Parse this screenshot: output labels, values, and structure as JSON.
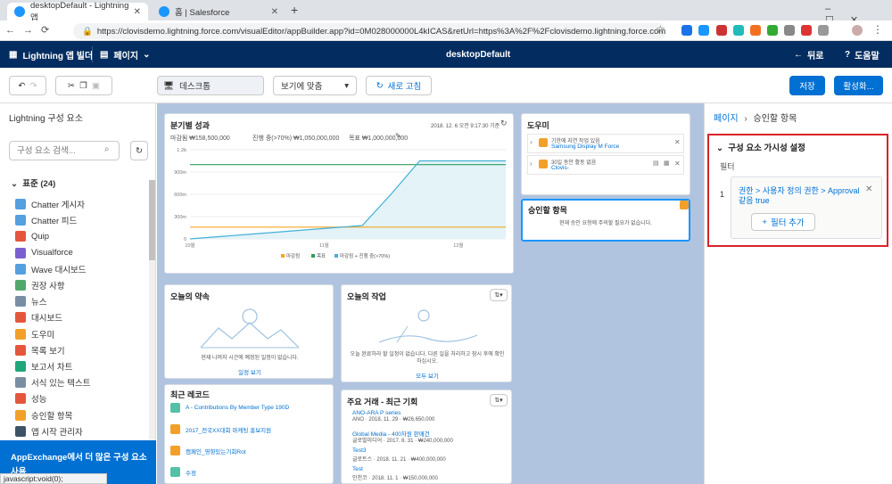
{
  "browser": {
    "tabs": [
      {
        "title": "desktopDefault - Lightning 앱"
      },
      {
        "title": "홈 | Salesforce"
      }
    ],
    "new_tab": "+",
    "url": "https://clovisdemo.lightning.force.com/visualEditor/appBuilder.app?id=0M028000000L4kICAS&retUrl=https%3A%2F%2Fclovisdemo.lightning.force.com..."
  },
  "header": {
    "app_title": "Lightning 앱 빌더",
    "page_menu": "페이지",
    "page_name": "desktopDefault",
    "back": "뒤로",
    "help": "도움말"
  },
  "toolbar": {
    "device": "데스크톱",
    "fit": "보기에 맞춤",
    "refresh": "새로 고침",
    "save": "저장",
    "activate": "활성화..."
  },
  "left": {
    "title": "Lightning 구성 요소",
    "search_placeholder": "구성 요소 검색...",
    "section": "표준 (24)",
    "items": [
      {
        "label": "Chatter 게시자",
        "color": "#54a0e0"
      },
      {
        "label": "Chatter 피드",
        "color": "#54a0e0"
      },
      {
        "label": "Quip",
        "color": "#e4573d"
      },
      {
        "label": "Visualforce",
        "color": "#7b5fd1"
      },
      {
        "label": "Wave 대시보드",
        "color": "#54a0e0"
      },
      {
        "label": "권장 사항",
        "color": "#51a86d"
      },
      {
        "label": "뉴스",
        "color": "#7a8ea3"
      },
      {
        "label": "대시보드",
        "color": "#e4573d"
      },
      {
        "label": "도우미",
        "color": "#f2a02a"
      },
      {
        "label": "목록 보기",
        "color": "#e4573d"
      },
      {
        "label": "보고서 차트",
        "color": "#1fa67a"
      },
      {
        "label": "서식 있는 텍스트",
        "color": "#7a8ea3"
      },
      {
        "label": "성능",
        "color": "#e4573d"
      },
      {
        "label": "승인할 항목",
        "color": "#f2a02a"
      },
      {
        "label": "앱 시작 관리자",
        "color": "#3e5266"
      }
    ],
    "appexchange": "AppExchange에서 더 많은 구성 요소 사용"
  },
  "canvas": {
    "perf": {
      "title": "분기별 성과",
      "timestamp": "2018. 12. 6 오전 9:17:30 기준",
      "closed": "마감됨 ₩158,500,000",
      "in_progress": "진행 중(>70%) ₩1,050,000,000",
      "goal": "목표 ₩1,000,000,000"
    },
    "assistant": {
      "title": "도우미",
      "item1_text": "기한에 지연 작업 있음",
      "item1_link": "Samsung Display M Force",
      "item2_text": "30일 동안 활동 없음",
      "item2_link": "Clovis-"
    },
    "approvals": {
      "title": "승인할 항목",
      "empty": "현재 승인 요청에 주의할 필요가 없습니다."
    },
    "events": {
      "title": "오늘의 약속",
      "empty": "현재 나머지 시간에 예정된 일정이 없습니다.",
      "link": "일정 보기"
    },
    "tasks": {
      "title": "오늘의 작업",
      "empty": "오늘 완료하라 할 일정이 없습니다. 다른 일을 처리하고 잠시 후에 확인하십시오.",
      "link": "모두 보기"
    },
    "recent": {
      "title": "최근 레코드",
      "items": [
        "A - Contributions By Member Type 190D",
        "2017_전국XX대회 마케팅 홍보지원",
        "캠페인_영향있는기회Rot",
        "수정"
      ]
    },
    "deals": {
      "title": "주요 거래 - 최근 기회",
      "items": [
        {
          "name": "ANO-ARA P series",
          "meta": "ANO · 2018. 11. 29 · ₩26,650,000"
        },
        {
          "name": "Global Media - 400차원 판매건",
          "meta": "글로벌미디어 · 2017. 8. 31 · ₩240,000,000"
        },
        {
          "name": "Test3",
          "meta": "글로트스 · 2018. 11. 21 · ₩400,000,000"
        },
        {
          "name": "Test",
          "meta": "인천코 · 2018. 11. 1 · ₩150,000,000"
        }
      ]
    }
  },
  "chart_data": {
    "type": "line",
    "title": "",
    "y_ticks": [
      "1.2b",
      "900m",
      "600m",
      "300m",
      "0"
    ],
    "x_ticks": [
      "10월",
      "11월",
      "12월"
    ],
    "ylim": [
      0,
      1200000000
    ],
    "x": [
      0,
      1,
      2,
      3,
      4,
      5,
      6,
      7,
      8,
      9,
      10,
      11
    ],
    "series": [
      {
        "name": "마감됨",
        "color": "#f5a623",
        "values": [
          158500000,
          158500000,
          158500000,
          158500000,
          158500000,
          158500000,
          158500000,
          158500000,
          158500000,
          158500000,
          158500000,
          158500000
        ]
      },
      {
        "name": "목표",
        "color": "#2e9e5b",
        "values": [
          1000000000,
          1000000000,
          1000000000,
          1000000000,
          1000000000,
          1000000000,
          1000000000,
          1000000000,
          1000000000,
          1000000000,
          1000000000,
          1000000000
        ]
      },
      {
        "name": "마감됨 + 진행 중(>70%)",
        "color": "#43b0d6",
        "values": [
          0,
          30000000,
          60000000,
          90000000,
          120000000,
          150000000,
          180000000,
          600000000,
          1050000000,
          1050000000,
          1050000000,
          1050000000
        ]
      }
    ]
  },
  "right": {
    "breadcrumb_root": "페이지",
    "breadcrumb_leaf": "승인할 항목",
    "section": "구성 요소 가시성 설정",
    "filter_label": "필터",
    "filter_num": "1",
    "filter_text": "권한 > 사용자 정의 권한 > Approval 같음 true",
    "add_filter": "필터 추가"
  },
  "status": "javascript:void(0);"
}
